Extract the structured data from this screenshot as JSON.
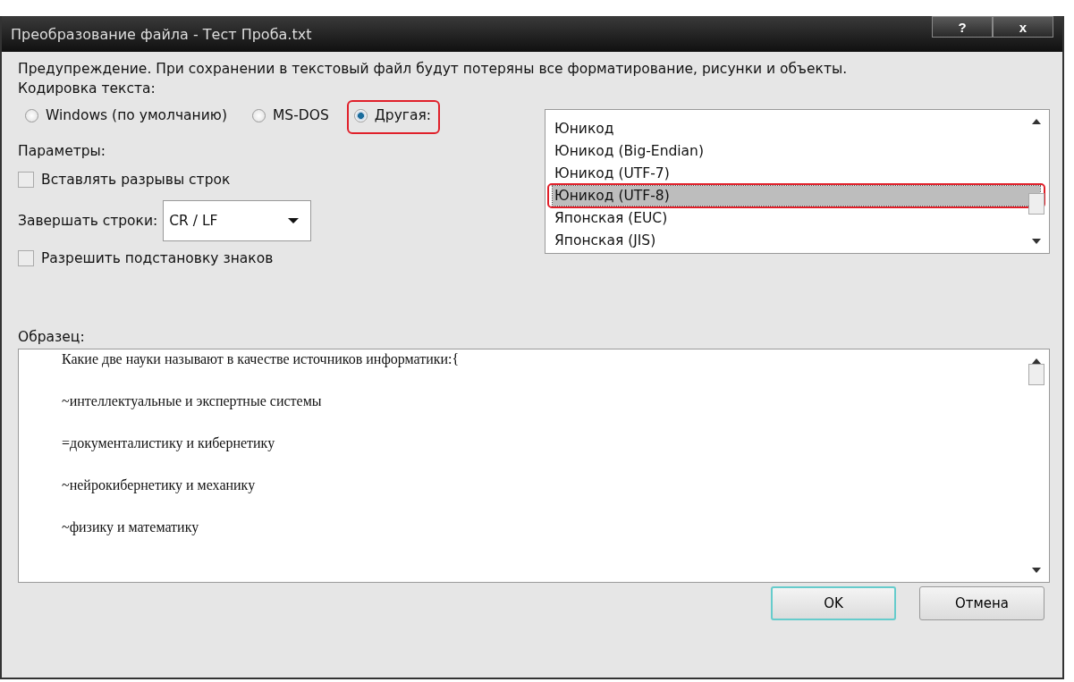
{
  "window": {
    "title": "Преобразование файла - Тест Проба.txt",
    "help_button": "?",
    "close_button": "x"
  },
  "warning": "Предупреждение. При сохранении в текстовый файл будут потеряны все форматирование, рисунки и объекты.",
  "encoding": {
    "label": "Кодировка текста:",
    "options": [
      {
        "label": "Windows (по умолчанию)",
        "selected": false,
        "highlighted": false
      },
      {
        "label": "MS-DOS",
        "selected": false,
        "highlighted": false
      },
      {
        "label": "Другая:",
        "selected": true,
        "highlighted": true
      }
    ],
    "list": [
      {
        "label": "Юникод",
        "selected": false,
        "highlighted": false
      },
      {
        "label": "Юникод (Big-Endian)",
        "selected": false,
        "highlighted": false
      },
      {
        "label": "Юникод (UTF-7)",
        "selected": false,
        "highlighted": false
      },
      {
        "label": "Юникод (UTF-8)",
        "selected": true,
        "highlighted": true
      },
      {
        "label": "Японская (EUC)",
        "selected": false,
        "highlighted": false
      },
      {
        "label": "Японская (JIS)",
        "selected": false,
        "highlighted": false
      }
    ]
  },
  "options": {
    "label": "Параметры:",
    "insert_line_breaks": {
      "label": "Вставлять разрывы строк",
      "checked": false
    },
    "line_ending": {
      "label": "Завершать строки:",
      "value": "CR / LF"
    },
    "allow_substitution": {
      "label": "Разрешить подстановку знаков",
      "checked": false
    }
  },
  "preview": {
    "label": "Образец:",
    "lines": [
      "Какие две науки называют в качестве источников информатики:{",
      "~интеллектуальные и экспертные системы",
      "=документалистику и кибернетику",
      "~нейрокибернетику и механику",
      "~физику и математику"
    ]
  },
  "buttons": [
    {
      "label": "OK",
      "default": true
    },
    {
      "label": "Отмена",
      "default": false
    }
  ]
}
